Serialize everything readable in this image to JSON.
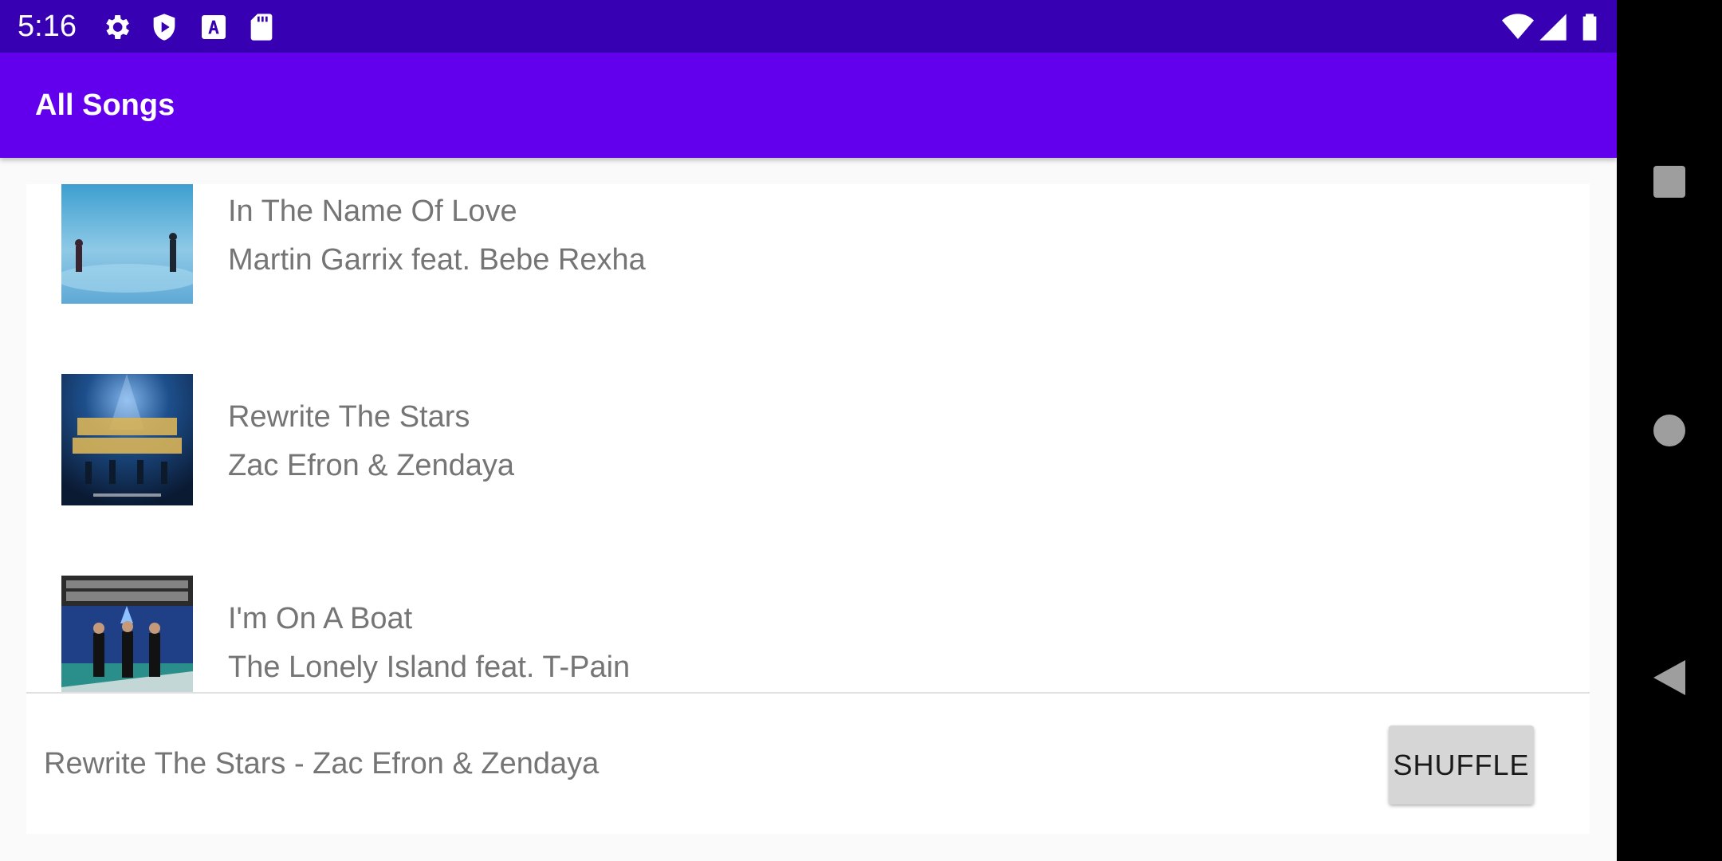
{
  "status_bar": {
    "time": "5:16",
    "left_icons": [
      "gear-icon",
      "shield-icon",
      "font-download-icon",
      "sd-card-icon"
    ],
    "right_icons": [
      "wifi-icon",
      "signal-icon",
      "battery-icon"
    ]
  },
  "app_bar": {
    "title": "All Songs",
    "color": "#6200ee",
    "status_color": "#3700b3"
  },
  "songs": [
    {
      "title": "In The Name Of Love",
      "artist": "Martin Garrix feat. Bebe Rexha"
    },
    {
      "title": "Rewrite The Stars",
      "artist": "Zac Efron & Zendaya"
    },
    {
      "title": "I'm On A Boat",
      "artist": "The Lonely Island feat. T-Pain"
    }
  ],
  "player": {
    "now_playing": "Rewrite The Stars - Zac Efron & Zendaya",
    "shuffle_label": "SHUFFLE"
  },
  "nav_bar": {
    "buttons": [
      "recents-square-icon",
      "home-circle-icon",
      "back-triangle-icon"
    ]
  }
}
